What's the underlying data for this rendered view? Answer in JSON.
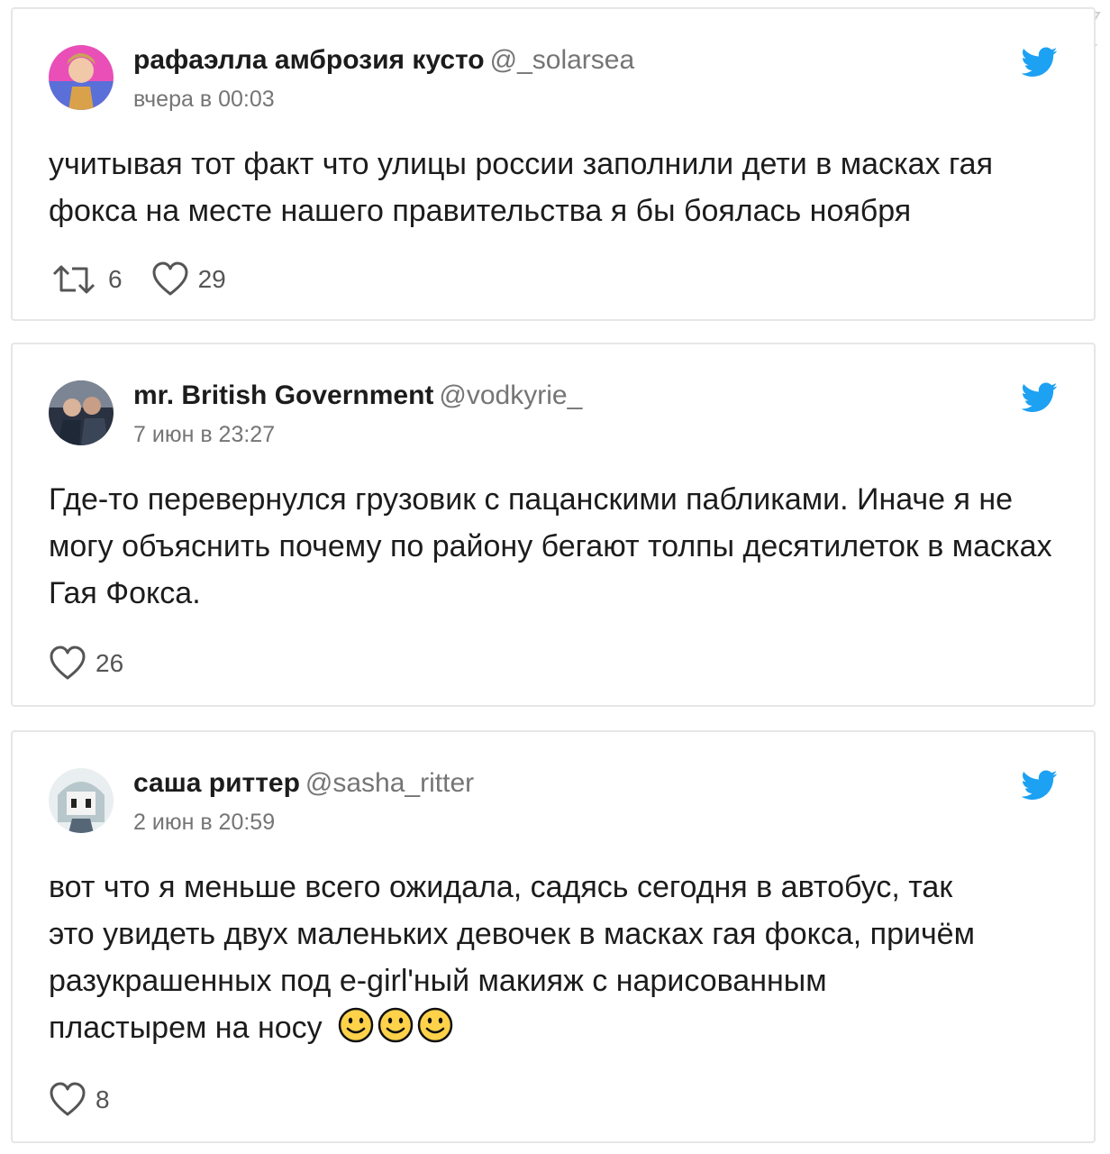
{
  "colors": {
    "twitter_blue": "#1da1f2",
    "handle_gray": "#757575",
    "border": "#e6e6e6",
    "emoji_yellow": "#ffd24a"
  },
  "tweets": [
    {
      "name": "рафаэлла амброзия кусто",
      "handle": "@_solarsea",
      "date": "вчера в 00:03",
      "text": "учитывая тот факт что улицы россии заполнили дети в масках гая фокса на месте нашего правительства я бы боялась ноября",
      "retweets": "6",
      "likes": "29",
      "icons": [
        "retweet-icon",
        "heart-icon",
        "twitter-bird-icon"
      ]
    },
    {
      "name": "mr. British Government",
      "handle": "@vodkyrie_",
      "date": "7 июн в 23:27",
      "text": "Где-то перевернулся грузовик с пацанскими пабликами. Иначе я не могу объяснить почему по району бегают толпы десятилеток в масках Гая Фокса.",
      "likes": "26",
      "icons": [
        "heart-icon",
        "twitter-bird-icon"
      ]
    },
    {
      "name": "саша риттер",
      "handle": "@sasha_ritter",
      "date": "2 июн в 20:59",
      "text_lines": [
        "вот что я меньше всего ожидала, садясь сегодня в автобус, так",
        "это увидеть двух маленьких девочек в масках гая фокса, причём",
        "разукрашенных под e-girl'ный макияж с нарисованным",
        "пластырем на носу"
      ],
      "emoji": [
        "slightly-smiling-face-icon",
        "slightly-smiling-face-icon",
        "slightly-smiling-face-icon"
      ],
      "likes": "8",
      "icons": [
        "heart-icon",
        "twitter-bird-icon"
      ]
    }
  ]
}
